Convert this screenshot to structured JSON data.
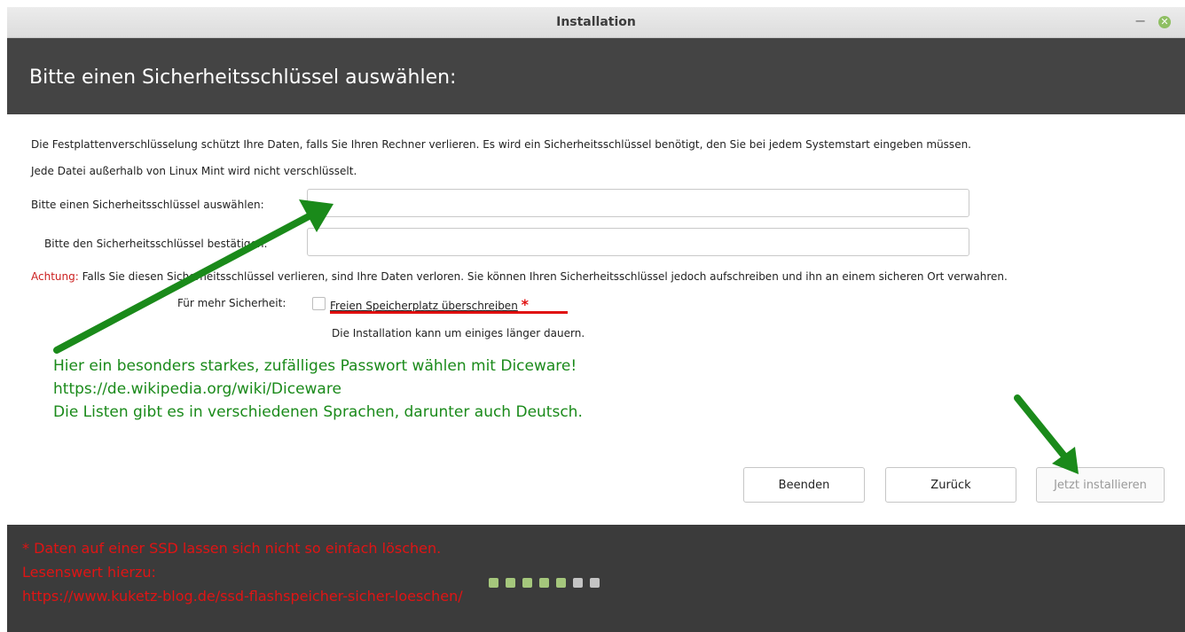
{
  "window": {
    "title": "Installation",
    "minimize_symbol": "−",
    "close_symbol": "✕"
  },
  "header": {
    "title": "Bitte einen Sicherheitsschlüssel auswählen:"
  },
  "content": {
    "description_line1": "Die Festplattenverschlüsselung schützt Ihre Daten, falls Sie Ihren Rechner verlieren. Es wird ein Sicherheitsschlüssel benötigt, den Sie bei jedem Systemstart eingeben müssen.",
    "description_line2": "Jede Datei außerhalb von Linux Mint wird nicht verschlüsselt.",
    "key_label": "Bitte einen Sicherheitsschlüssel auswählen:",
    "key_value": "",
    "confirm_label": "Bitte den Sicherheitsschlüssel bestätigen:",
    "confirm_value": "",
    "warning_prefix": "Achtung:",
    "warning_text": " Falls Sie diesen Sicherheitsschlüssel verlieren, sind Ihre Daten verloren. Sie können Ihren Sicherheitsschlüssel jedoch aufschreiben und ihn an einem sicheren Ort verwahren.",
    "security_label": "Für mehr Sicherheit:",
    "overwrite_label": "Freien Speicherplatz überschreiben",
    "overwrite_checked": false,
    "overwrite_marker": "*",
    "overwrite_hint": "Die Installation kann um einiges länger dauern."
  },
  "annotation": {
    "line1": "Hier ein besonders starkes, zufälliges Passwort wählen mit Diceware!",
    "line2": "https://de.wikipedia.org/wiki/Diceware",
    "line3": "Die Listen gibt es in verschiedenen Sprachen, darunter auch Deutsch.",
    "color": "#1a8a1a"
  },
  "buttons": {
    "quit": "Beenden",
    "back": "Zurück",
    "install": "Jetzt installieren"
  },
  "footer": {
    "line1": "* Daten auf einer SSD lassen sich nicht so einfach löschen.",
    "line2": "Lesenswert hierzu:",
    "line3": "https://www.kuketz-blog.de/ssd-flashspeicher-sicher-loeschen/",
    "color": "#e01414",
    "progress_steps_total": 7,
    "progress_steps_done": 5
  },
  "colors": {
    "header_bg": "#444444",
    "footer_bg": "#3b3b3b",
    "arrow": "#1a8a1a",
    "underline": "#e01010"
  }
}
